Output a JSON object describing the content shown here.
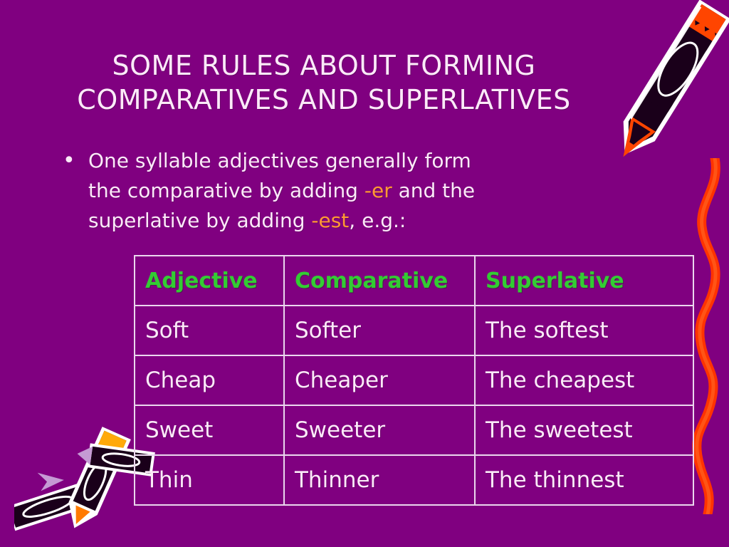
{
  "slide": {
    "background_color": "#800080",
    "title_lines": [
      "SOME RULES ABOUT FORMING",
      "COMPARATIVES AND SUPERLATIVES"
    ],
    "title_color": "#FBEAF8"
  },
  "bullet": {
    "marker": "•",
    "part1": "One syllable adjectives generally form the comparative by adding ",
    "suffix_er": "-er",
    "part2": " and the superlative by adding ",
    "suffix_est": "-est",
    "part3": ", e.g.:",
    "highlight_color": "#FF9933"
  },
  "table": {
    "header_color": "#33CC33",
    "border_color": "#EBD7EE",
    "columns": [
      "Adjective",
      "Comparative",
      "Superlative"
    ],
    "rows": [
      [
        "Soft",
        "Softer",
        "The softest"
      ],
      [
        "Cheap",
        "Cheaper",
        "The cheapest"
      ],
      [
        "Sweet",
        "Sweeter",
        "The sweetest"
      ],
      [
        "Thin",
        "Thinner",
        "The thinnest"
      ]
    ]
  },
  "decorations": {
    "crayon_top_right": "crayon-diagonal-icon",
    "squiggle_line": "wavy-crayon-stroke-icon",
    "crayons_bottom_left": "scattered-crayons-icon",
    "crayon_body_color": "#110011",
    "crayon_tip_color": "#FF4500",
    "squiggle_color": "#FF3300",
    "crayon_highlight_color": "#FFFFFF",
    "crayon_eraser_color": "#FFA90A"
  }
}
